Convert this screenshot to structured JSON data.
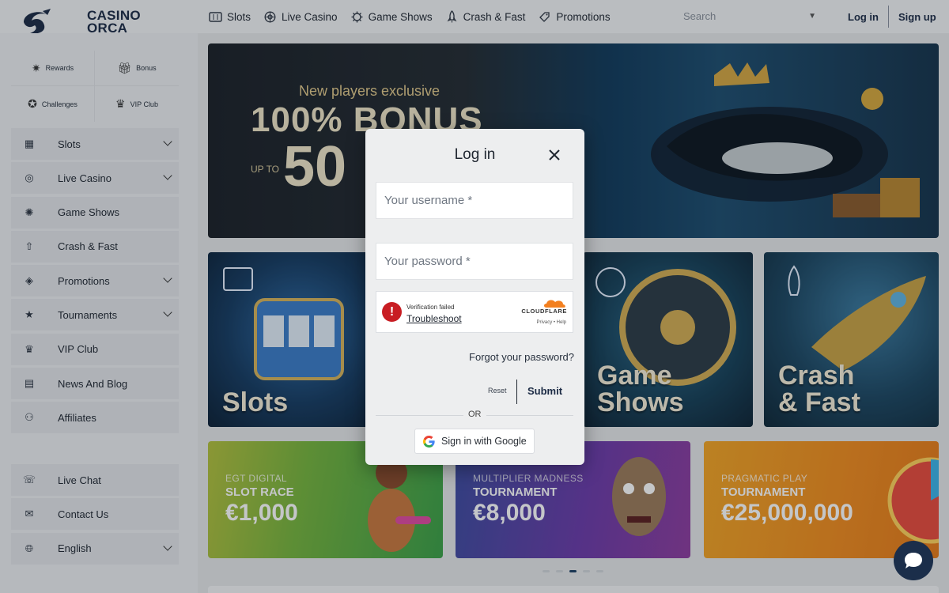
{
  "brand": {
    "name_line1": "CASINO",
    "name_line2": "ORCA"
  },
  "topnav": [
    {
      "label": "Slots",
      "icon": "slot-machine-icon"
    },
    {
      "label": "Live Casino",
      "icon": "roulette-icon"
    },
    {
      "label": "Game Shows",
      "icon": "wheel-icon"
    },
    {
      "label": "Crash & Fast",
      "icon": "rocket-icon"
    },
    {
      "label": "Promotions",
      "icon": "tag-icon"
    }
  ],
  "search": {
    "placeholder": "Search"
  },
  "auth": {
    "login": "Log in",
    "signup": "Sign up"
  },
  "quick_links": [
    {
      "label": "Rewards",
      "icon": "rewards-icon"
    },
    {
      "label": "Bonus",
      "icon": "gift-icon"
    },
    {
      "label": "Challenges",
      "icon": "medal-icon"
    },
    {
      "label": "VIP Club",
      "icon": "crown-icon"
    }
  ],
  "sidebar_menu": [
    {
      "label": "Slots",
      "icon": "slot-machine-icon",
      "expandable": true
    },
    {
      "label": "Live Casino",
      "icon": "roulette-icon",
      "expandable": true
    },
    {
      "label": "Game Shows",
      "icon": "wheel-icon",
      "expandable": false
    },
    {
      "label": "Crash & Fast",
      "icon": "rocket-icon",
      "expandable": false
    },
    {
      "label": "Promotions",
      "icon": "tag-icon",
      "expandable": true
    },
    {
      "label": "Tournaments",
      "icon": "trophy-icon",
      "expandable": true
    },
    {
      "label": "VIP Club",
      "icon": "crown-icon",
      "expandable": false
    },
    {
      "label": "News And Blog",
      "icon": "document-icon",
      "expandable": false
    },
    {
      "label": "Affiliates",
      "icon": "affiliates-icon",
      "expandable": false
    }
  ],
  "sidebar_bottom": [
    {
      "label": "Live Chat",
      "icon": "chat-icon",
      "expandable": false
    },
    {
      "label": "Contact Us",
      "icon": "contact-icon",
      "expandable": false
    },
    {
      "label": "English",
      "icon": "translate-icon",
      "expandable": true
    }
  ],
  "hero": {
    "exclusive": "New players exclusive",
    "bonus": "100% BONUS",
    "upto": "UP TO",
    "amount": "50"
  },
  "tiles": [
    {
      "title_line1": "Slots",
      "title_line2": ""
    },
    {
      "title_line1": "Game",
      "title_line2": "Shows"
    },
    {
      "title_line1": "Crash",
      "title_line2": "& Fast"
    }
  ],
  "promos": [
    {
      "provider": "EGT DIGITAL",
      "title": "SLOT RACE",
      "amount": "€1,000"
    },
    {
      "provider": "MULTIPLIER MADNESS",
      "title": "TOURNAMENT",
      "amount": "€8,000"
    },
    {
      "provider": "PRAGMATIC PLAY",
      "title": "TOURNAMENT",
      "amount": "€25,000,000"
    }
  ],
  "carousel": {
    "active_index": 2,
    "count": 5
  },
  "login_modal": {
    "title": "Log in",
    "username_placeholder": "Your username *",
    "password_placeholder": "Your password *",
    "captcha_status": "Verification failed",
    "captcha_link": "Troubleshoot",
    "captcha_brand": "CLOUDFLARE",
    "captcha_privacy": "Privacy • Help",
    "forgot": "Forgot your password?",
    "reset": "Reset",
    "submit": "Submit",
    "or": "OR",
    "google": "Sign in with Google"
  },
  "colors": {
    "brand_navy": "#1b2a44",
    "error_red": "#c81d23",
    "cloudflare_orange": "#f38020"
  }
}
